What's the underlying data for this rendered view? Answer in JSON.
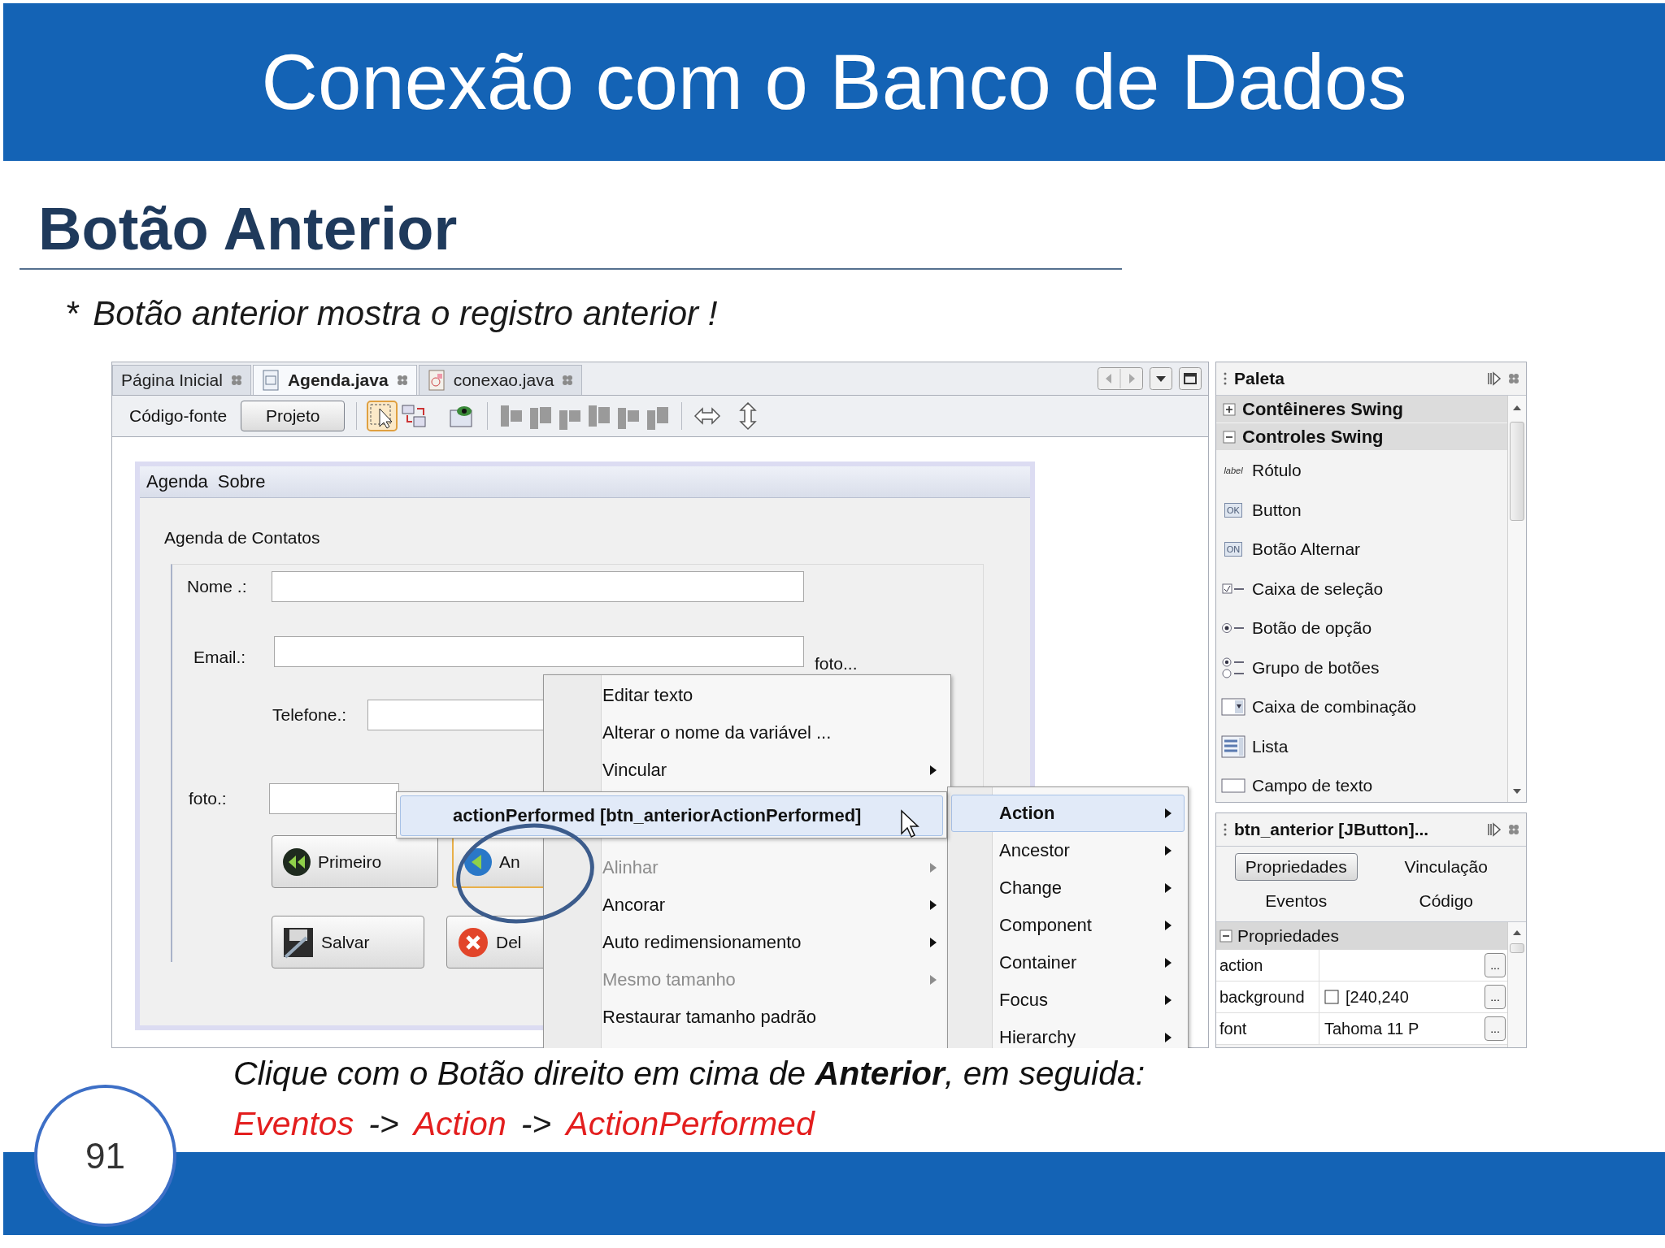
{
  "slide": {
    "title": "Conexão com o Banco de Dados",
    "heading": "Botão Anterior",
    "bullet_mark": "*",
    "bullet_text": "Botão anterior mostra o registro anterior !"
  },
  "ide": {
    "tabs": [
      {
        "label": "Página Inicial",
        "kind": "page",
        "selected": false
      },
      {
        "label": "Agenda.java",
        "kind": "form",
        "selected": true
      },
      {
        "label": "conexao.java",
        "kind": "class",
        "selected": false
      }
    ],
    "views": [
      {
        "label": "Código-fonte",
        "selected": false
      },
      {
        "label": "Projeto",
        "selected": true
      }
    ],
    "selection_tool_active": true,
    "form": {
      "menu": [
        "Agenda",
        "Sobre"
      ],
      "group_title": "Agenda de Contatos",
      "fields": [
        {
          "label": "Nome .:"
        },
        {
          "label": "Email.:"
        },
        {
          "label": "Telefone.:"
        },
        {
          "label": "foto.:"
        }
      ],
      "photo_link": "foto...",
      "buttons": [
        {
          "label": "Primeiro",
          "kind": "first",
          "selected": false
        },
        {
          "label": "An",
          "kind": "previous",
          "selected": true
        },
        {
          "label": "Salvar",
          "kind": "save",
          "selected": false
        },
        {
          "label": "Del",
          "kind": "delete",
          "selected": false
        }
      ]
    },
    "context_menu": {
      "items_above": [
        {
          "label": "Editar texto",
          "disabled": false,
          "submenu": false
        },
        {
          "label": "Alterar o nome da variável ...",
          "disabled": false,
          "submenu": false
        },
        {
          "label": "Vincular",
          "disabled": false,
          "submenu": true
        }
      ],
      "items_below": [
        {
          "label": "Alinhar",
          "disabled": true,
          "submenu": true
        },
        {
          "label": "Ancorar",
          "disabled": false,
          "submenu": true
        },
        {
          "label": "Auto redimensionamento",
          "disabled": false,
          "submenu": true
        },
        {
          "label": "Mesmo tamanho",
          "disabled": true,
          "submenu": true
        },
        {
          "label": "Restaurar tamanho padrão",
          "disabled": false,
          "submenu": false
        }
      ]
    },
    "event_item": {
      "label": "actionPerformed [btn_anteriorActionPerformed]",
      "selected": true
    },
    "event_groups": [
      {
        "label": "Action",
        "selected": true
      },
      {
        "label": "Ancestor",
        "selected": false
      },
      {
        "label": "Change",
        "selected": false
      },
      {
        "label": "Component",
        "selected": false
      },
      {
        "label": "Container",
        "selected": false
      },
      {
        "label": "Focus",
        "selected": false
      },
      {
        "label": "Hierarchy",
        "selected": false
      }
    ]
  },
  "palette": {
    "title": "Paleta",
    "categories": [
      {
        "label": "Contêineres Swing",
        "expanded": false
      },
      {
        "label": "Controles Swing",
        "expanded": true
      }
    ],
    "items": [
      {
        "label": "Rótulo",
        "kind": "label",
        "badge": "label"
      },
      {
        "label": "Button",
        "kind": "button",
        "badge": "OK"
      },
      {
        "label": "Botão Alternar",
        "kind": "toggle",
        "badge": "ON"
      },
      {
        "label": "Caixa de seleção",
        "kind": "checkbox"
      },
      {
        "label": "Botão de opção",
        "kind": "radio"
      },
      {
        "label": "Grupo de botões",
        "kind": "group"
      },
      {
        "label": "Caixa de combinação",
        "kind": "combo"
      },
      {
        "label": "Lista",
        "kind": "list"
      },
      {
        "label": "Campo de texto",
        "kind": "textfield"
      }
    ]
  },
  "properties": {
    "title": "btn_anterior [JButton]...",
    "tabs": [
      {
        "label": "Propriedades",
        "selected": true
      },
      {
        "label": "Vinculação",
        "selected": false
      },
      {
        "label": "Eventos",
        "selected": false
      },
      {
        "label": "Código",
        "selected": false
      }
    ],
    "section": "Propriedades",
    "section_expanded": true,
    "rows": [
      {
        "name": "action",
        "button": "..."
      },
      {
        "name": "background",
        "value": "[240,240",
        "button": "..."
      },
      {
        "name": "font",
        "value": "Tahoma 11 P",
        "button": "..."
      }
    ]
  },
  "caption": {
    "line1": "Clique com o Botão direito em cima de **Anterior**, em seguida:",
    "line2": [
      {
        "text": "Eventos",
        "color": "#e31e1e"
      },
      {
        "text": "->",
        "color": "#1a1a1a"
      },
      {
        "text": "Action",
        "color": "#e31e1e"
      },
      {
        "text": "->",
        "color": "#1a1a1a"
      },
      {
        "text": "ActionPerformed",
        "color": "#e31e1e"
      }
    ]
  },
  "page_number": "91"
}
